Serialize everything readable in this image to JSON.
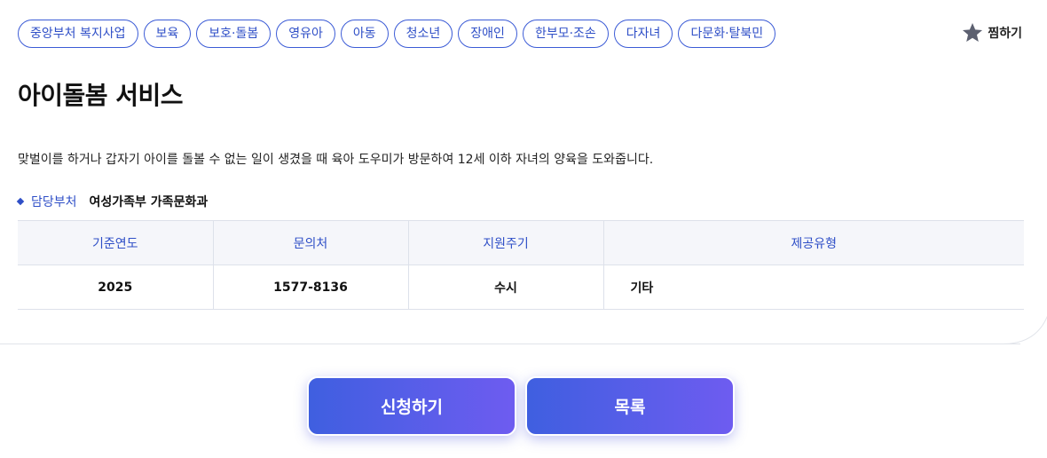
{
  "tags": [
    "중앙부처 복지사업",
    "보육",
    "보호·돌봄",
    "영유아",
    "아동",
    "청소년",
    "장애인",
    "한부모·조손",
    "다자녀",
    "다문화·탈북민"
  ],
  "favorite": {
    "label": "찜하기",
    "icon": "star-icon"
  },
  "title": "아이돌봄 서비스",
  "description": "맞벌이를 하거나 갑자기 아이를 돌볼 수 없는 일이 생겼을 때 육아 도우미가 방문하여 12세 이하 자녀의 양육을 도와줍니다.",
  "department": {
    "label": "담당부처",
    "value": "여성가족부 가족문화과"
  },
  "table": {
    "headers": [
      "기준연도",
      "문의처",
      "지원주기",
      "제공유형"
    ],
    "row": [
      "2025",
      "1577-8136",
      "수시",
      "기타"
    ]
  },
  "buttons": {
    "apply": "신청하기",
    "list": "목록"
  },
  "colors": {
    "accent": "#2f4fc7",
    "gradient_start": "#3f5fe0",
    "gradient_end": "#6e5cf0"
  }
}
